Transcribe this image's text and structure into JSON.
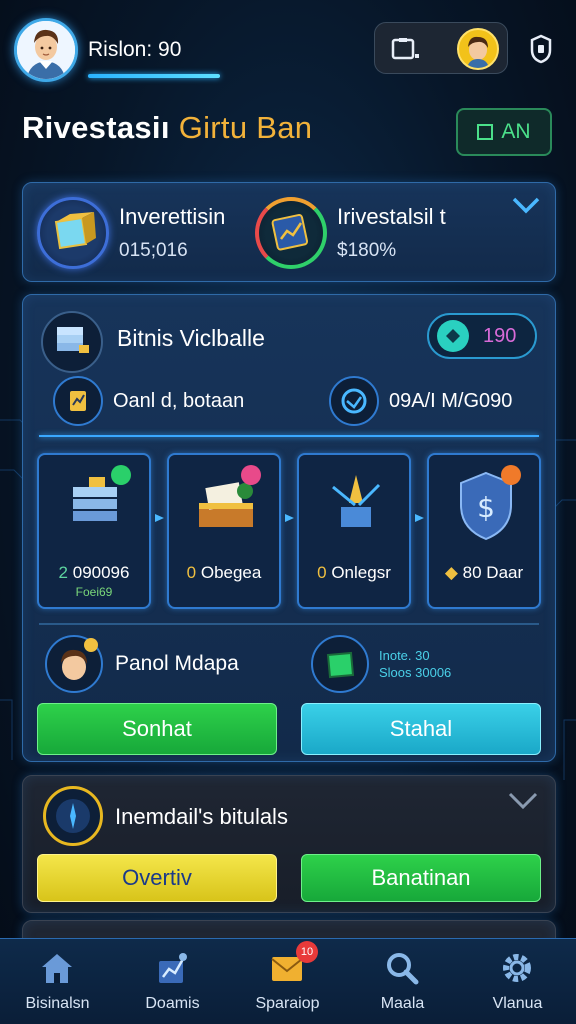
{
  "header": {
    "username": "Rislon: 90",
    "xp_progress_percent": 100
  },
  "title": {
    "part1": "Rivestasiı",
    "part2": "Girtu Ban",
    "button_label": "AN"
  },
  "investments": [
    {
      "title": "Inverettisin",
      "value": "015;016"
    },
    {
      "title": "Irivestalsil t",
      "value": "$180%"
    }
  ],
  "business": {
    "title": "Bitnis Viclballe",
    "coin_value": "190",
    "row_left": "Oanl d, botaan",
    "row_right": "09A/I  M/G090"
  },
  "cards": [
    {
      "prefix": "2",
      "label": "090096",
      "sub": "Foei69"
    },
    {
      "prefix": "0",
      "label": "Obegea",
      "sub": ""
    },
    {
      "prefix": "0",
      "label": "Onlegsr",
      "sub": ""
    },
    {
      "prefix": "",
      "label": "80 Daar",
      "sub": ""
    }
  ],
  "panel_row": {
    "left_label": "Panol Mdapa",
    "right_line1": "Inote. 30",
    "right_line2": "Sloos 30006"
  },
  "buttons": {
    "left": "Sonhat",
    "right": "Stahal"
  },
  "help": {
    "title": "Inemdail's bitulals",
    "button_left": "Overtiv",
    "button_right": "Banatinan"
  },
  "nav": {
    "items": [
      {
        "label": "Bisinalsn",
        "icon": "home-icon"
      },
      {
        "label": "Doamis",
        "icon": "chart-icon"
      },
      {
        "label": "Sparaiop",
        "icon": "mail-icon",
        "badge": "10"
      },
      {
        "label": "Maala",
        "icon": "search-icon"
      },
      {
        "label": "Vlanua",
        "icon": "gear-icon"
      }
    ]
  },
  "colors": {
    "accent": "#2ab3ff",
    "gold": "#f2b23a",
    "green": "#2ed14a",
    "cyan": "#3ad0e8",
    "yellow": "#f4e64a"
  }
}
